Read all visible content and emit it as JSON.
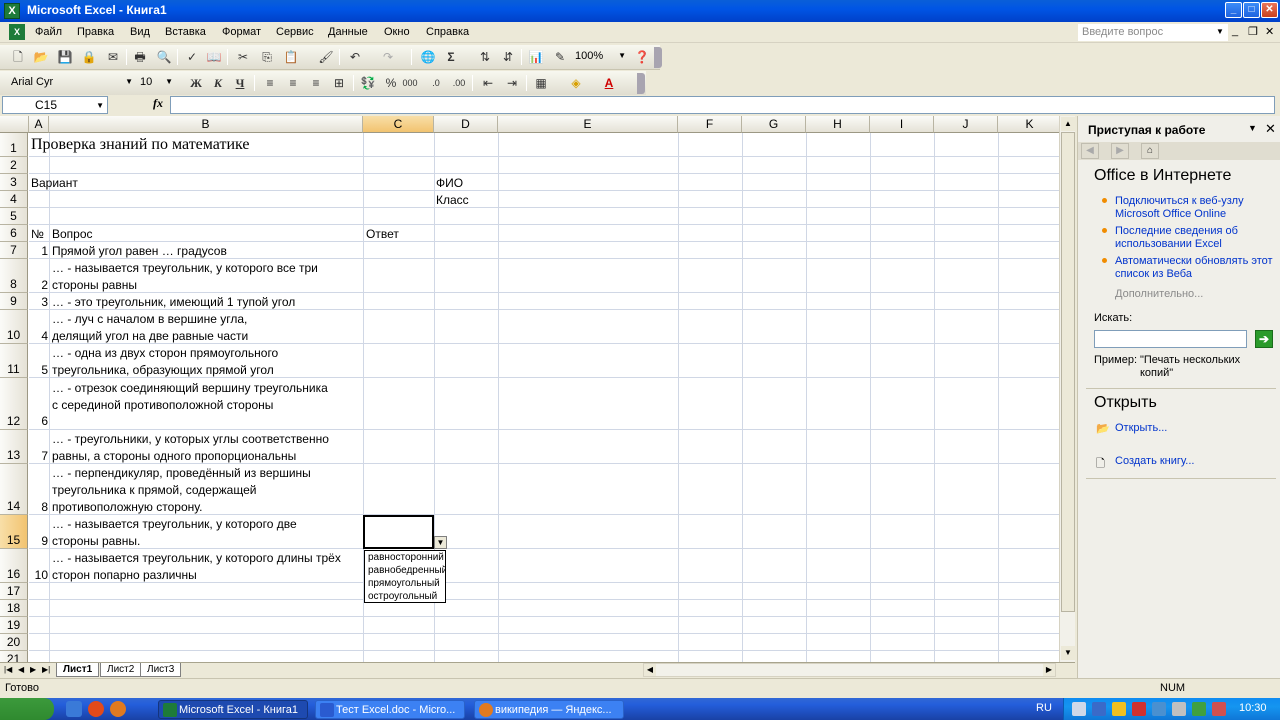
{
  "window": {
    "title": "Microsoft Excel - Книга1"
  },
  "menu": {
    "items": [
      "Файл",
      "Правка",
      "Вид",
      "Вставка",
      "Формат",
      "Сервис",
      "Данные",
      "Окно",
      "Справка"
    ],
    "ask_placeholder": "Введите вопрос"
  },
  "toolbar": {
    "zoom": "100%",
    "font_name": "Arial Cyr",
    "font_size": "10",
    "bold": "Ж",
    "italic": "К",
    "underline": "Ч",
    "percent": "%",
    "thousands": "000",
    "sigma": "Σ"
  },
  "formula_bar": {
    "name_box": "C15",
    "fx": "fx",
    "formula": ""
  },
  "grid": {
    "columns": [
      "A",
      "B",
      "C",
      "D",
      "E",
      "F",
      "G",
      "H",
      "I",
      "J",
      "K"
    ],
    "selected_column": "C",
    "rows": [
      "1",
      "2",
      "3",
      "4",
      "5",
      "6",
      "7",
      "8",
      "9",
      "10",
      "11",
      "12",
      "13",
      "14",
      "15",
      "16",
      "17",
      "18",
      "19",
      "20",
      "21"
    ],
    "selected_row": "15",
    "cells": {
      "A1": "Проверка знаний по математике",
      "A3": "Вариант",
      "D3": "ФИО",
      "D4": "Класс",
      "A6": "№",
      "B6": "Вопрос",
      "C6": "Ответ",
      "A7": "1",
      "B7": "Прямой угол равен … градусов",
      "A8": "2",
      "B8": "… - называется треугольник, у которого все три стороны равны",
      "A9": "3",
      "B9": "… - это треугольник, имеющий 1 тупой угол",
      "A10": "4",
      "B10": "… - луч с началом в вершине угла, делящий угол на две равные части",
      "A11": "5",
      "B11": "… - одна из двух сторон прямоугольного треугольника, образующих прямой угол",
      "A12": "6",
      "B12": "… - отрезок соединяющий вершину треугольника с серединой противоположной стороны",
      "A13": "7",
      "B13": "… - треугольники, у которых углы соответственно равны, а стороны одного пропорциональны",
      "A14": "8",
      "B14": "… - перпендикуляр, проведённый из вершины треугольника к прямой, содержащей противоположную сторону.",
      "A15": "9",
      "B15": "… - называется треугольник, у которого две стороны равны.",
      "A16": "10",
      "B16": "… - называется треугольник, у которого длины трёх сторон попарно различны"
    },
    "dropdown_options": [
      "равносторонний",
      "равнобедренный",
      "прямоугольный",
      "остроугольный"
    ]
  },
  "sheets": {
    "tabs": [
      "Лист1",
      "Лист2",
      "Лист3"
    ],
    "active": "Лист1"
  },
  "task_pane": {
    "title": "Приступая к работе",
    "section1": "Office в Интернете",
    "links": [
      "Подключиться к веб-узлу Microsoft Office Online",
      "Последние сведения об использовании Excel",
      "Автоматически обновлять этот список из Веба"
    ],
    "more": "Дополнительно...",
    "search_label": "Искать:",
    "example_label": "Пример:",
    "example_text": "\"Печать нескольких копий\"",
    "section2": "Открыть",
    "open_link": "Открыть...",
    "create_link": "Создать книгу..."
  },
  "status": {
    "text": "Готово",
    "num": "NUM"
  },
  "taskbar": {
    "tasks": [
      "Microsoft Excel - Книга1",
      "Тест Excel.doc - Micro...",
      "википедия — Яндекс..."
    ],
    "lang": "RU",
    "clock": "10:30"
  },
  "colors": {
    "title_bar": "#0055E5",
    "selection_header": "#F2C370",
    "link": "#0033CC",
    "taskbar": "#245EDB"
  }
}
